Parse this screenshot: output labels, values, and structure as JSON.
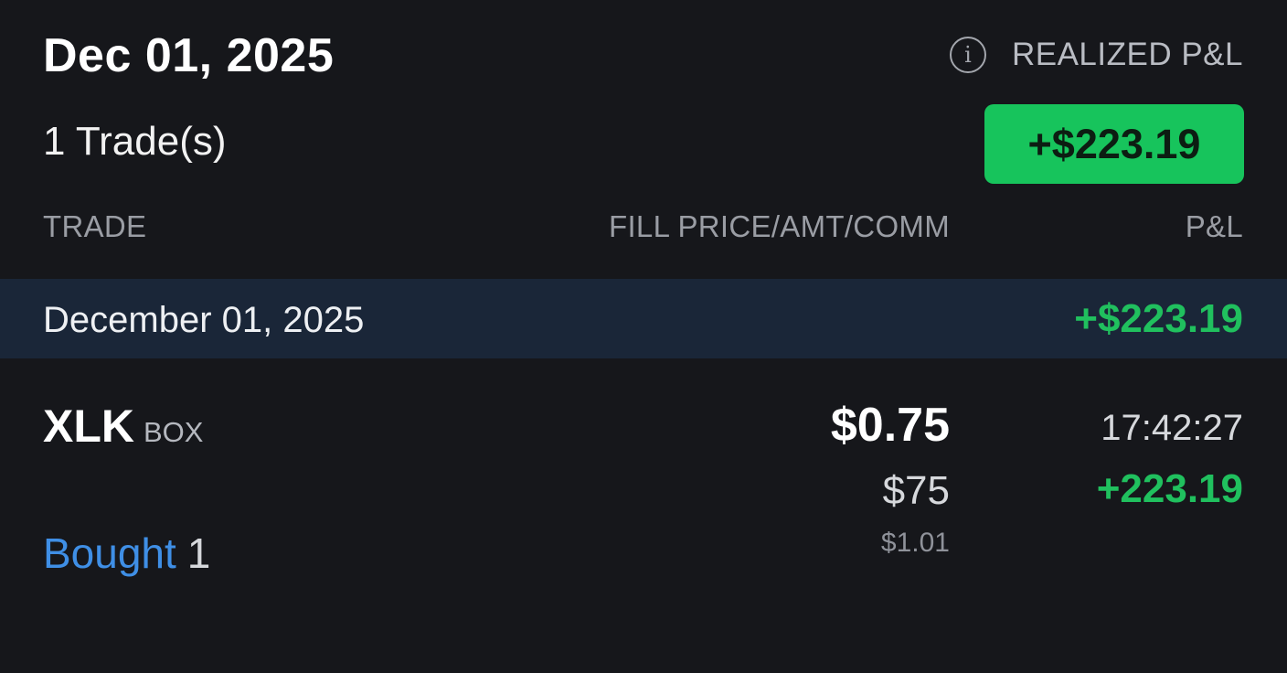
{
  "header": {
    "date": "Dec 01, 2025",
    "trade_count": "1 Trade(s)",
    "realized_label": "REALIZED P&L",
    "realized_total": "+$223.19",
    "info_icon": "info-icon"
  },
  "columns": {
    "trade": "TRADE",
    "fill": "FILL PRICE/AMT/COMM",
    "pnl": "P&L"
  },
  "day": {
    "date": "December 01, 2025",
    "pnl": "+$223.19"
  },
  "trade": {
    "symbol": "XLK",
    "exchange": "BOX",
    "fill_price": "$0.75",
    "amount": "$75",
    "commission": "$1.01",
    "time": "17:42:27",
    "pnl": "+223.19",
    "action": "Bought",
    "quantity": "1"
  },
  "colors": {
    "background": "#16171b",
    "accent_green": "#17c45c",
    "positive_text": "#20c05e",
    "day_row": "#1a2638",
    "action_blue": "#3f8fe6"
  }
}
